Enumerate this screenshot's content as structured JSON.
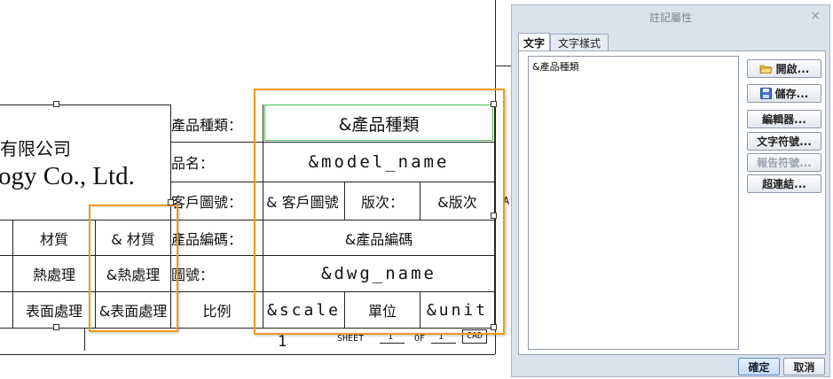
{
  "drawing": {
    "company_cn": "有限公司",
    "company_en": "ogy Co., Ltd.",
    "rows": {
      "material_label": "材質",
      "material_value": "&  材質",
      "heat_label": "熱處理",
      "heat_value": "&熱處理",
      "surface_label": "表面處理",
      "surface_value": "&表面處理",
      "scale_label": "比例"
    },
    "fields": {
      "product_type_label": "產品種類：",
      "product_type_value": "&產品種類",
      "name_label": "品名：",
      "name_value": "&model_name",
      "customer_dwg_label": "客戶圖號：",
      "customer_dwg_value": "&  客戶圖號",
      "revision_label": "版次：",
      "revision_value": "&版次",
      "product_code_label": "產品編碼：",
      "product_code_value": "&產品編碼",
      "dwg_no_label": "圖號：",
      "dwg_no_value": "&dwg_name",
      "scale_value": "&scale",
      "unit_label": "單位",
      "unit_value": "&unit"
    },
    "sheet": {
      "number": "1",
      "sheet_label": "SHEET",
      "sheet_value": "1",
      "of_label": "OF",
      "of_value": "1",
      "cad_label": "CAD"
    },
    "edge_letter": "A"
  },
  "dialog": {
    "title": "註記屬性",
    "close": "×",
    "tabs": [
      {
        "label": "文字"
      },
      {
        "label": "文字樣式"
      }
    ],
    "text_content": "&產品種類",
    "buttons": {
      "open": "開啟...",
      "save": "儲存...",
      "editor": "編輯器...",
      "text_symbol": "文字符號...",
      "report_symbol": "報告符號...",
      "hyperlink": "超連結..."
    },
    "ok": "確定",
    "cancel": "取消"
  }
}
